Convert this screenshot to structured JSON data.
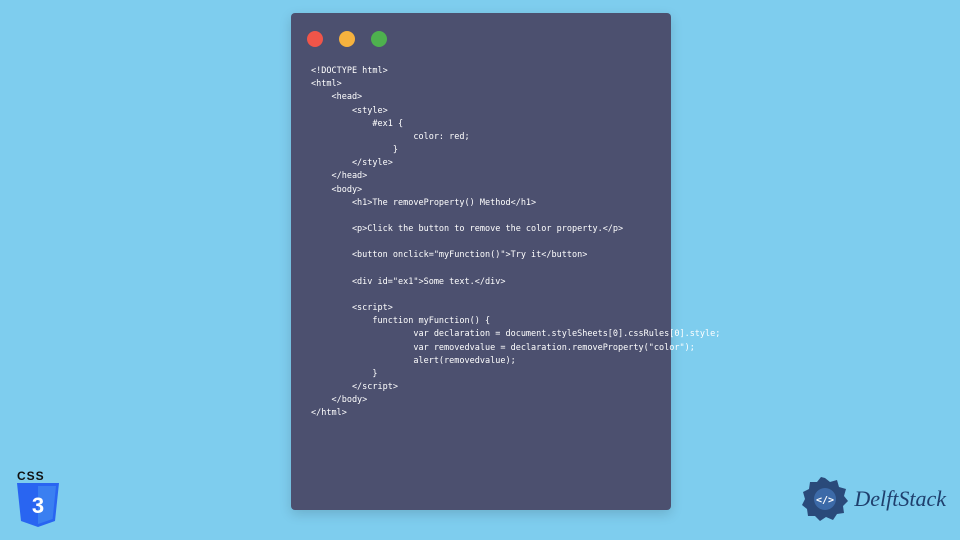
{
  "window": {
    "traffic": {
      "red": "close",
      "yellow": "minimize",
      "green": "maximize"
    }
  },
  "code": {
    "lines": "<!DOCTYPE html>\n<html>\n    <head>\n        <style>\n            #ex1 {\n                    color: red;\n                }\n        </style>\n    </head>\n    <body>\n        <h1>The removeProperty() Method</h1>\n\n        <p>Click the button to remove the color property.</p>\n\n        <button onclick=\"myFunction()\">Try it</button>\n\n        <div id=\"ex1\">Some text.</div>\n\n        <script>\n            function myFunction() {\n                    var declaration = document.styleSheets[0].cssRules[0].style;\n                    var removedvalue = declaration.removeProperty(\"color\");\n                    alert(removedvalue);\n            }\n        </script>\n    </body>\n</html>"
  },
  "css_logo": {
    "label": "CSS",
    "number": "3"
  },
  "delft": {
    "text": "DelftStack"
  }
}
